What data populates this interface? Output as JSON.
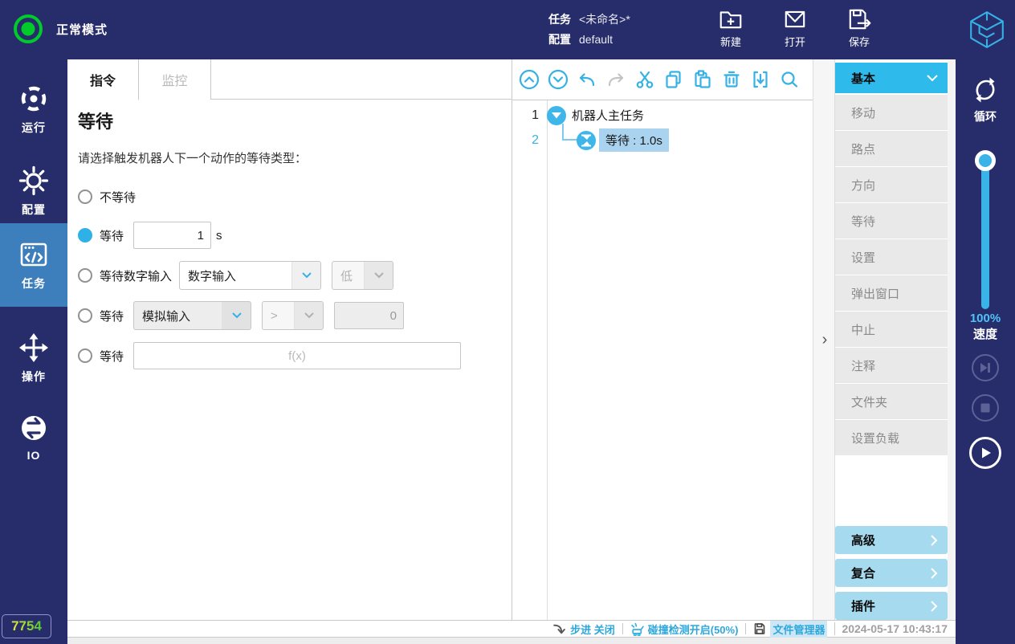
{
  "topbar": {
    "mode": "正常模式",
    "task_label": "任务",
    "task_value": "<未命名>*",
    "config_label": "配置",
    "config_value": "default",
    "new_label": "新建",
    "open_label": "打开",
    "save_label": "保存"
  },
  "sidebar": {
    "items": [
      {
        "label": "运行",
        "icon": "run-icon",
        "active": false
      },
      {
        "label": "配置",
        "icon": "config-icon",
        "active": false
      },
      {
        "label": "任务",
        "icon": "task-icon",
        "active": true
      },
      {
        "label": "操作",
        "icon": "operate-icon",
        "active": false
      },
      {
        "label": "IO",
        "icon": "io-icon",
        "active": false
      }
    ],
    "counter": "7754"
  },
  "editor": {
    "tabs": [
      {
        "label": "指令",
        "active": true
      },
      {
        "label": "监控",
        "active": false
      }
    ],
    "title": "等待",
    "description": "请选择触发机器人下一个动作的等待类型：",
    "options": {
      "no_wait": {
        "label": "不等待",
        "selected": false
      },
      "wait_time": {
        "label": "等待",
        "selected": true,
        "value": "1",
        "unit": "s"
      },
      "wait_digital": {
        "label": "等待数字输入",
        "selected": false,
        "source": "数字输入",
        "level": "低"
      },
      "wait_analog": {
        "label": "等待",
        "selected": false,
        "source": "模拟输入",
        "operator": ">",
        "value": "0"
      },
      "wait_expr": {
        "label": "等待",
        "selected": false,
        "placeholder": "f(x)"
      }
    }
  },
  "tree": {
    "toolbar_icons": [
      "collapse-all-icon",
      "expand-all-icon",
      "undo-icon",
      "redo-icon",
      "cut-icon",
      "copy-icon",
      "paste-icon",
      "delete-icon",
      "insert-icon",
      "search-icon"
    ],
    "nodes": [
      {
        "line": "1",
        "label": "机器人主任务",
        "selected": false
      },
      {
        "line": "2",
        "label": "等待 : 1.0s",
        "selected": true
      }
    ],
    "expander": "›"
  },
  "palette": {
    "header": "基本",
    "items": [
      "移动",
      "路点",
      "方向",
      "等待",
      "设置",
      "弹出窗口",
      "中止",
      "注释",
      "文件夹",
      "设置负载"
    ],
    "groups": [
      "高级",
      "复合",
      "插件"
    ]
  },
  "rightbar": {
    "loop_label": "循环",
    "speed_value": "100%",
    "speed_label": "速度"
  },
  "statusbar": {
    "step": "步进 关闭",
    "collision": "碰撞检测开启(50%)",
    "file_manager": "文件管理器",
    "timestamp": "2024-05-17 10:43:17"
  },
  "colors": {
    "navy": "#272D6B",
    "accent_blue": "#36B1E6",
    "selected_nav": "#3D7EBD",
    "selection_bg": "#A9D3EE",
    "palette_header": "#2EBBEC",
    "palette_group": "#A6DAEE",
    "status_green": "#00CB2A"
  }
}
